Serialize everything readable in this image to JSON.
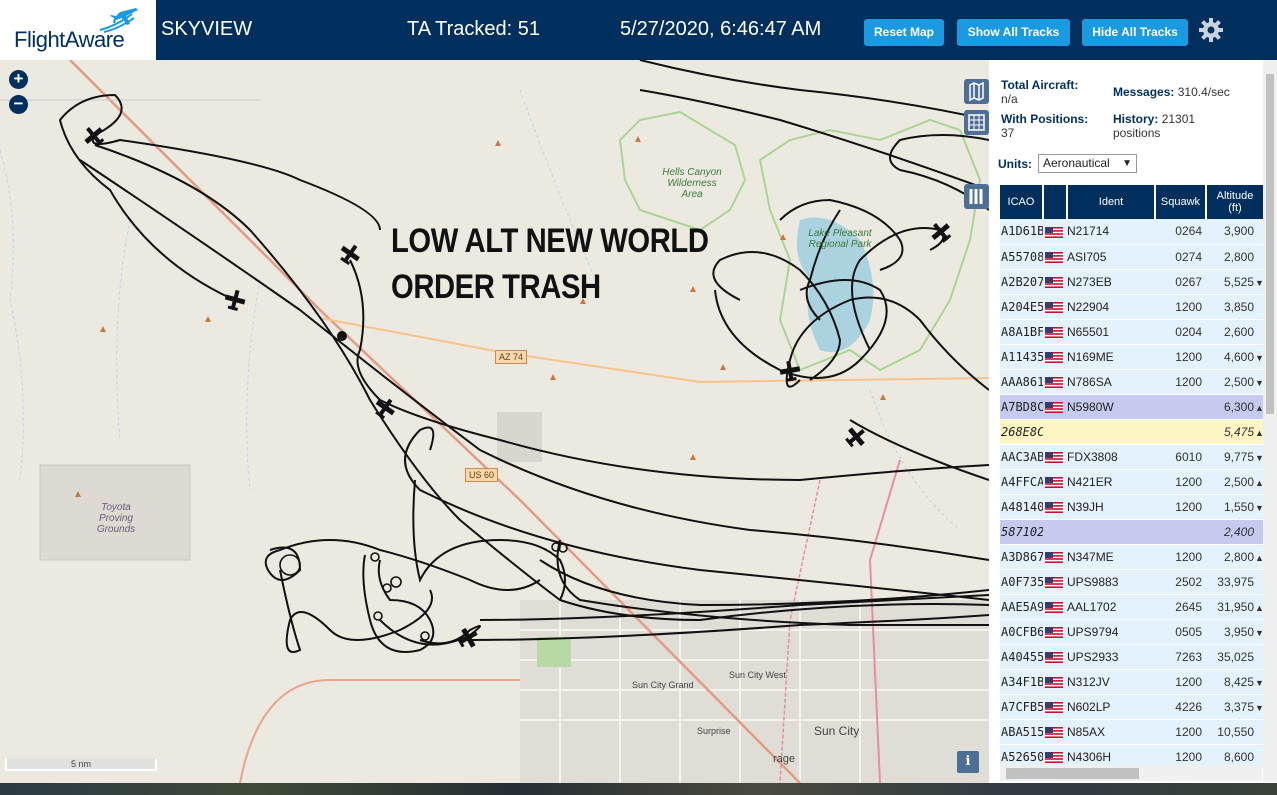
{
  "header": {
    "logo_text": "FlightAware",
    "app_name": "SKYVIEW",
    "tracked": "TA Tracked: 51",
    "datetime": "5/27/2020, 6:46:47 AM",
    "buttons": {
      "reset_map": "Reset Map",
      "show_all": "Show All Tracks",
      "hide_all": "Hide All Tracks"
    },
    "settings_icon": "gear-icon"
  },
  "map": {
    "annotation": [
      "LOW ALT NEW WORLD",
      "ORDER TRASH"
    ],
    "zoom_in": "+",
    "zoom_out": "−",
    "scale": "5 nm",
    "info": "i",
    "labels": {
      "hells_canyon": "Hells Canyon Wilderness Area",
      "lake_pleasant": "Lake Pleasant Regional Park",
      "toyota": "Toyota Proving Grounds",
      "sun_city": "Sun City",
      "sun_city_grand": "Sun City Grand",
      "sun_city_west": "Sun City West",
      "surprise": "Surprise",
      "mirage": "rage"
    },
    "road_shields": {
      "az74": "AZ 74",
      "us60": "US 60"
    },
    "tools": [
      "map-layers-icon",
      "grid-icon",
      "columns-icon"
    ]
  },
  "sidebar": {
    "total_aircraft_label": "Total Aircraft:",
    "total_aircraft_value": "n/a",
    "with_positions_label": "With Positions:",
    "with_positions_value": "37",
    "messages_label": "Messages:",
    "messages_value": "310.4/sec",
    "history_label": "History:",
    "history_value": "21301",
    "history_unit": "positions",
    "units_label": "Units:",
    "units_value": "Aeronautical",
    "columns": {
      "icao": "ICAO",
      "ident": "Ident",
      "squawk": "Squawk",
      "altitude": "Altitude",
      "altitude_unit": "(ft)"
    },
    "rows": [
      {
        "icao": "A1D61B",
        "ident": "N21714",
        "squawk": "0264",
        "alt": "3,900",
        "trend": "",
        "flag": true,
        "style": ""
      },
      {
        "icao": "A55708",
        "ident": "ASI705",
        "squawk": "0274",
        "alt": "2,800",
        "trend": "",
        "flag": true,
        "style": ""
      },
      {
        "icao": "A2B207",
        "ident": "N273EB",
        "squawk": "0267",
        "alt": "5,525",
        "trend": "▼",
        "flag": true,
        "style": ""
      },
      {
        "icao": "A204E5",
        "ident": "N22904",
        "squawk": "1200",
        "alt": "3,850",
        "trend": "",
        "flag": true,
        "style": ""
      },
      {
        "icao": "A8A1BF",
        "ident": "N65501",
        "squawk": "0204",
        "alt": "2,600",
        "trend": "",
        "flag": true,
        "style": ""
      },
      {
        "icao": "A11435",
        "ident": "N169ME",
        "squawk": "1200",
        "alt": "4,600",
        "trend": "▼",
        "flag": true,
        "style": ""
      },
      {
        "icao": "AAA861",
        "ident": "N786SA",
        "squawk": "1200",
        "alt": "2,500",
        "trend": "▼",
        "flag": true,
        "style": ""
      },
      {
        "icao": "A7BD8C",
        "ident": "N5980W",
        "squawk": "",
        "alt": "6,300",
        "trend": "▲",
        "flag": true,
        "style": "sel"
      },
      {
        "icao": "268E8C",
        "ident": "",
        "squawk": "",
        "alt": "5,475",
        "trend": "▲",
        "flag": false,
        "style": "yellow ital"
      },
      {
        "icao": "AAC3AB",
        "ident": "FDX3808",
        "squawk": "6010",
        "alt": "9,775",
        "trend": "▼",
        "flag": true,
        "style": ""
      },
      {
        "icao": "A4FFCA",
        "ident": "N421ER",
        "squawk": "1200",
        "alt": "2,500",
        "trend": "▲",
        "flag": true,
        "style": ""
      },
      {
        "icao": "A48140",
        "ident": "N39JH",
        "squawk": "1200",
        "alt": "1,550",
        "trend": "▼",
        "flag": true,
        "style": ""
      },
      {
        "icao": "587102",
        "ident": "",
        "squawk": "",
        "alt": "2,400",
        "trend": "",
        "flag": false,
        "style": "sel ital"
      },
      {
        "icao": "A3D867",
        "ident": "N347ME",
        "squawk": "1200",
        "alt": "2,800",
        "trend": "▲",
        "flag": true,
        "style": ""
      },
      {
        "icao": "A0F735",
        "ident": "UPS9883",
        "squawk": "2502",
        "alt": "33,975",
        "trend": "",
        "flag": true,
        "style": ""
      },
      {
        "icao": "AAE5A9",
        "ident": "AAL1702",
        "squawk": "2645",
        "alt": "31,950",
        "trend": "▲",
        "flag": true,
        "style": ""
      },
      {
        "icao": "A0CFB6",
        "ident": "UPS9794",
        "squawk": "0505",
        "alt": "3,950",
        "trend": "▼",
        "flag": true,
        "style": ""
      },
      {
        "icao": "A40455",
        "ident": "UPS2933",
        "squawk": "7263",
        "alt": "35,025",
        "trend": "",
        "flag": true,
        "style": ""
      },
      {
        "icao": "A34F1B",
        "ident": "N312JV",
        "squawk": "1200",
        "alt": "8,425",
        "trend": "▼",
        "flag": true,
        "style": ""
      },
      {
        "icao": "A7CFB5",
        "ident": "N602LP",
        "squawk": "4226",
        "alt": "3,375",
        "trend": "▼",
        "flag": true,
        "style": ""
      },
      {
        "icao": "ABA515",
        "ident": "N85AX",
        "squawk": "1200",
        "alt": "10,550",
        "trend": "",
        "flag": true,
        "style": ""
      },
      {
        "icao": "A52650",
        "ident": "N4306H",
        "squawk": "1200",
        "alt": "8,600",
        "trend": "",
        "flag": true,
        "style": ""
      }
    ]
  },
  "colors": {
    "header_bg": "#002f5d",
    "button": "#1a9ae0",
    "row_bg": "#e4f2fd",
    "row_selected": "#c4cbef",
    "row_highlight": "#fdf5c4"
  }
}
